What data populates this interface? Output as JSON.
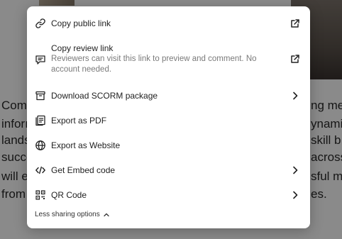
{
  "background": {
    "left_lines": [
      "Com",
      "inforı",
      "lands",
      "succe",
      "will e",
      "from"
    ],
    "right_lines": [
      "ng me",
      "ynamic",
      "skill b",
      "across",
      "sful m",
      "es."
    ]
  },
  "menu": {
    "items": [
      {
        "label": "Copy public link",
        "icon": "link-icon",
        "trailing_icon": "external-link-icon"
      },
      {
        "label": "Copy review link",
        "description": "Reviewers can visit this link to preview and comment. No account needed.",
        "icon": "comment-icon",
        "trailing_icon": "external-link-icon"
      },
      {
        "label": "Download SCORM package",
        "icon": "archive-icon",
        "trailing_icon": "chevron-right-icon"
      },
      {
        "label": "Export as PDF",
        "icon": "pdf-icon"
      },
      {
        "label": "Export as Website",
        "icon": "globe-icon"
      },
      {
        "label": "Get Embed code",
        "icon": "code-icon",
        "trailing_icon": "chevron-right-icon",
        "highlighted": true
      },
      {
        "label": "QR Code",
        "icon": "qr-code-icon",
        "trailing_icon": "chevron-right-icon"
      }
    ],
    "footer_label": "Less sharing options"
  },
  "colors": {
    "highlight_border": "#e5241b",
    "highlight_bg": "#f1f2f4",
    "overlay": "rgba(0,0,0,0.46)"
  }
}
